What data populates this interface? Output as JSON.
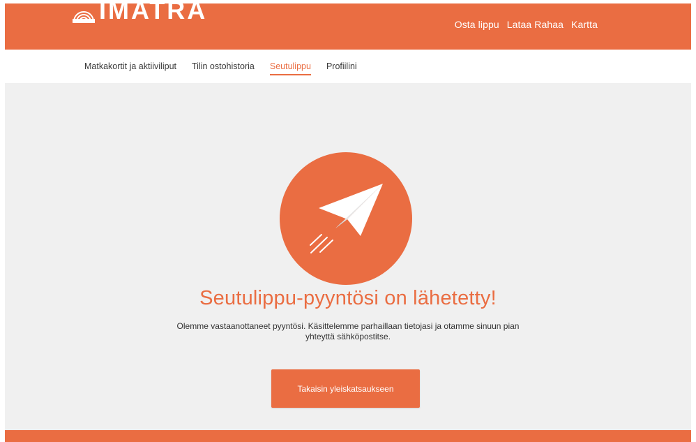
{
  "brand": {
    "logo_text": "IMATRA",
    "accent_color": "#ea6d42"
  },
  "topnav": {
    "items": [
      {
        "label": "Osta lippu"
      },
      {
        "label": "Lataa Rahaa"
      },
      {
        "label": "Kartta"
      }
    ]
  },
  "subnav": {
    "items": [
      {
        "label": "Matkakortit ja aktiiviliput",
        "active": false
      },
      {
        "label": "Tilin ostohistoria",
        "active": false
      },
      {
        "label": "Seutulippu",
        "active": true
      },
      {
        "label": "Profiilini",
        "active": false
      }
    ]
  },
  "confirmation": {
    "icon": "paper-plane-icon",
    "title": "Seutulippu-pyyntösi on lähetetty!",
    "message": "Olemme vastaanottaneet pyyntösi. Käsittelemme parhaillaan tietojasi ja otamme sinuun pian yhteyttä sähköpostitse.",
    "button_label": "Takaisin yleiskatsaukseen"
  }
}
